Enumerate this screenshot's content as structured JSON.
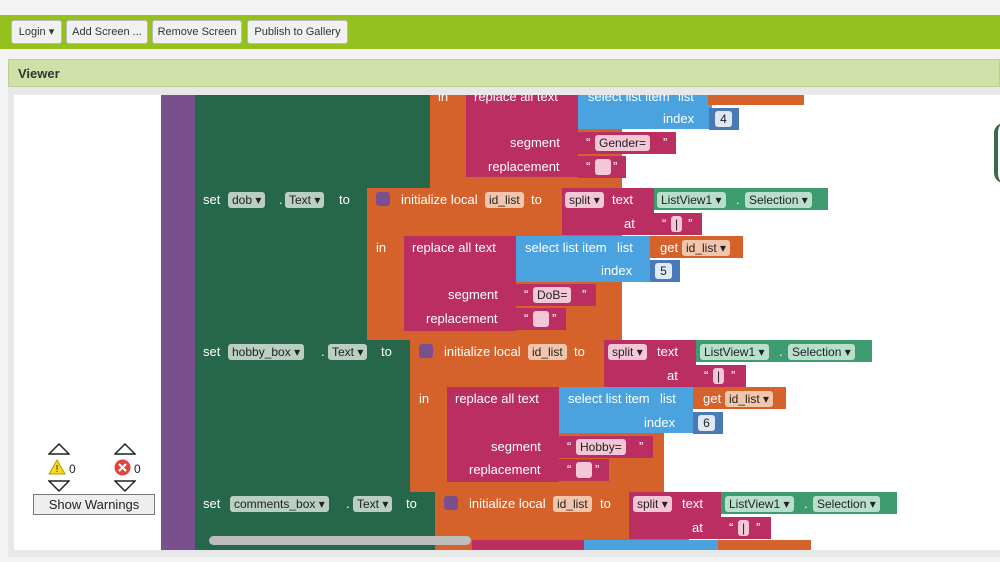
{
  "toolbar": {
    "login": "Login",
    "add_screen": "Add Screen ...",
    "remove_screen": "Remove Screen",
    "publish": "Publish to Gallery"
  },
  "viewer": {
    "title": "Viewer"
  },
  "warnings": {
    "warning_count": "0",
    "error_count": "0",
    "show_label": "Show Warnings"
  },
  "blocks": {
    "kw_set": "set",
    "kw_to": "to",
    "kw_text": "Text",
    "kw_in": "in",
    "kw_init_local": "initialize local",
    "kw_split": "split",
    "kw_text_lower": "text",
    "kw_at": "at",
    "kw_replace_all": "replace all text",
    "kw_select_item": "select list item",
    "kw_list": "list",
    "kw_index": "index",
    "kw_segment": "segment",
    "kw_replacement": "replacement",
    "kw_get": "get",
    "var_id_list": "id_list",
    "listview": "ListView1",
    "selection": "Selection",
    "quote_open": "“",
    "quote_close": "”",
    "pipe": "|",
    "group0": {
      "segment_value": "Gender=",
      "index": "4"
    },
    "group1": {
      "component": "dob",
      "segment_value": "DoB=",
      "index": "5"
    },
    "group2": {
      "component": "hobby_box",
      "segment_value": "Hobby=",
      "index": "6"
    },
    "group3": {
      "component": "comments_box"
    }
  }
}
